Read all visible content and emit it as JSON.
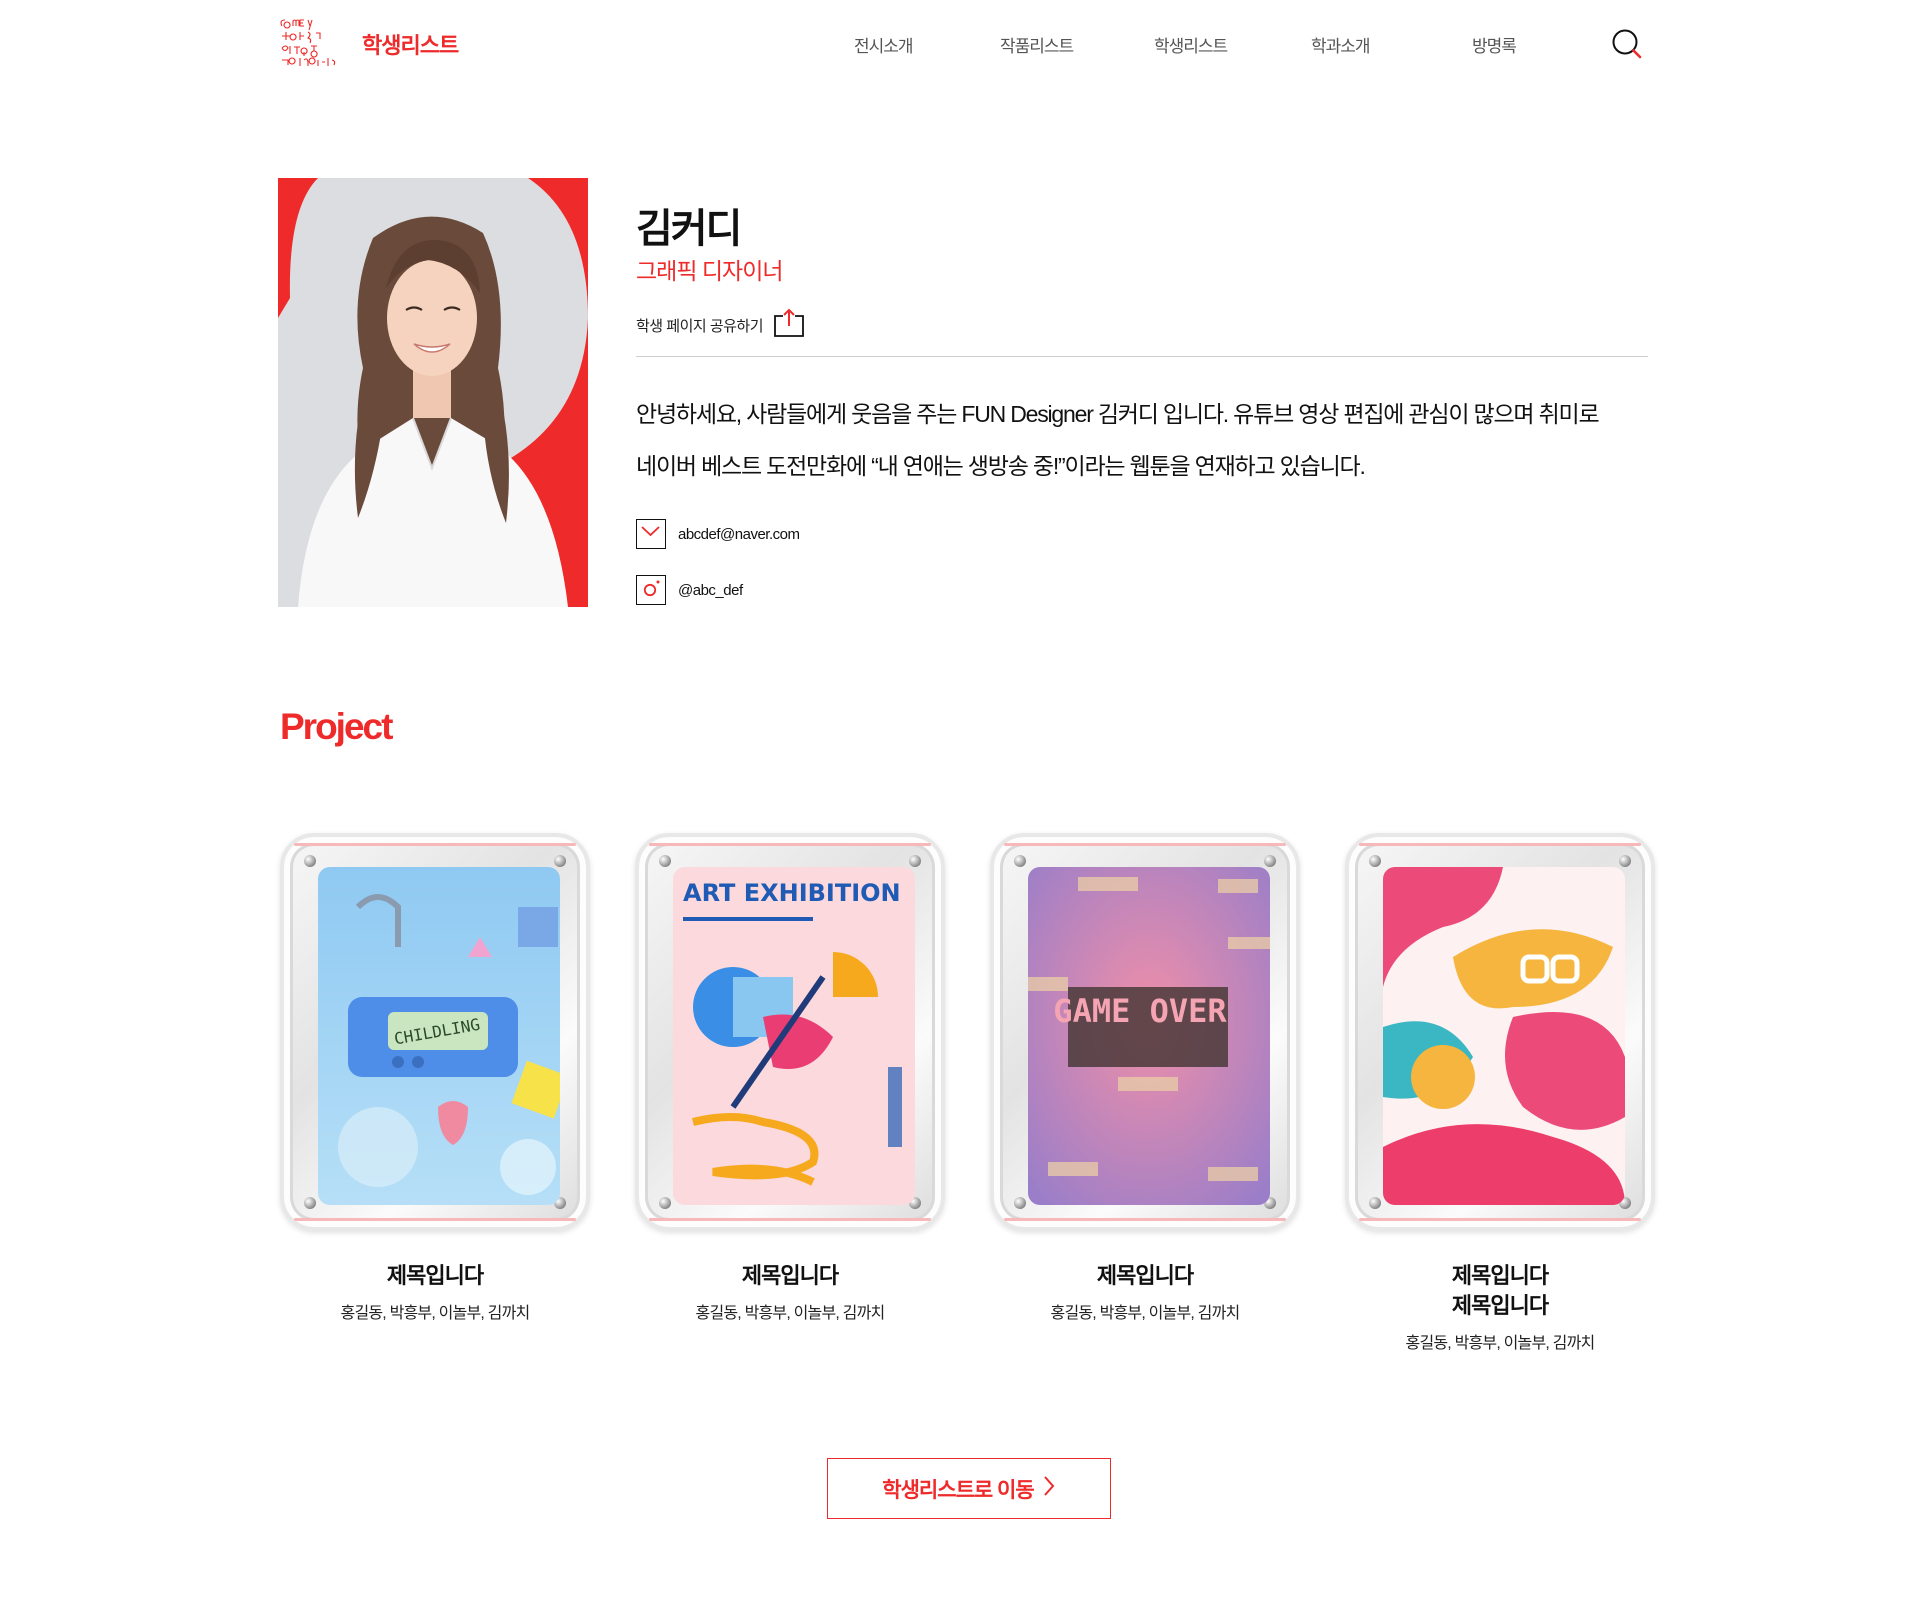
{
  "header": {
    "logo_title": "학생리스트",
    "nav": [
      "전시소개",
      "작품리스트",
      "학생리스트",
      "학과소개",
      "방명록"
    ]
  },
  "profile": {
    "name": "김커디",
    "role": "그래픽 디자이너",
    "share_label": "학생 페이지 공유하기",
    "bio": [
      "안녕하세요, 사람들에게 웃음을 주는 FUN Designer 김커디 입니다. 유튜브 영상 편집에 관심이 많으며 취미로",
      "네이버 베스트 도전만화에 “내 연애는 생방송 중!”이라는 웹툰을 연재하고 있습니다."
    ],
    "email": "abcdef@naver.com",
    "instagram": "@abc_def"
  },
  "projects": {
    "section_title": "Project",
    "items": [
      {
        "title": [
          "제목입니다"
        ],
        "members": "홍길동, 박흥부, 이놀부, 김까치",
        "art_text": "CHILDLING"
      },
      {
        "title": [
          "제목입니다"
        ],
        "members": "홍길동, 박흥부, 이놀부, 김까치",
        "art_text": "ART EXHIBITION"
      },
      {
        "title": [
          "제목입니다"
        ],
        "members": "홍길동, 박흥부, 이놀부, 김까치",
        "art_text": "GAME OVER"
      },
      {
        "title": [
          "제목입니다",
          "제목입니다"
        ],
        "members": "홍길동, 박흥부, 이놀부, 김까치",
        "art_text": ""
      }
    ]
  },
  "footer_button": {
    "label": "학생리스트로 이동"
  },
  "colors": {
    "accent": "#ee2a2a",
    "text": "#111111",
    "nav": "#555555"
  },
  "icons": [
    "search-icon",
    "share-icon",
    "mail-icon",
    "instagram-icon",
    "chevron-right-icon"
  ]
}
